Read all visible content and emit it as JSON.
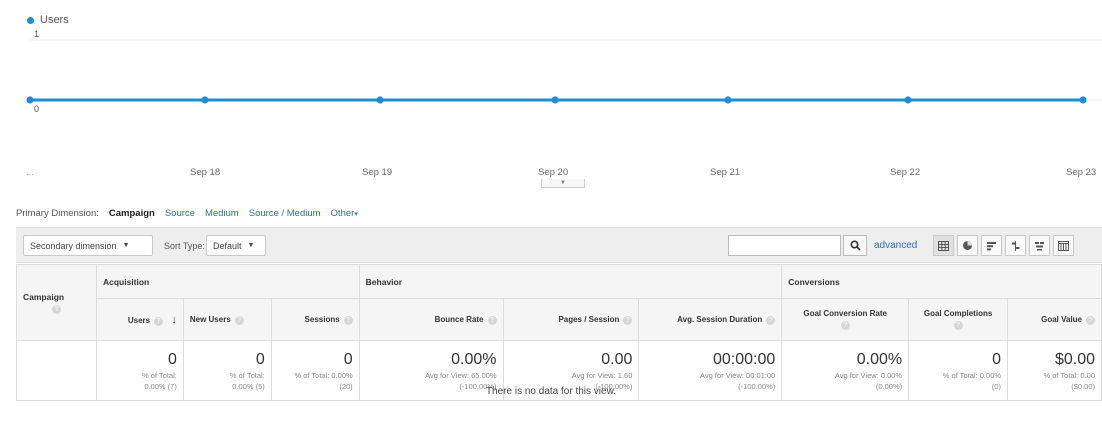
{
  "chart_data": {
    "type": "line",
    "series": [
      {
        "name": "Users",
        "color": "#1f8dd6",
        "values": [
          0,
          0,
          0,
          0,
          0,
          0,
          0
        ]
      }
    ],
    "x": [
      "",
      "Sep 18",
      "Sep 19",
      "Sep 20",
      "Sep 21",
      "Sep 22",
      "Sep 23"
    ],
    "y_ticks": [
      "1",
      "0"
    ],
    "ylim": [
      0,
      1
    ],
    "first_tick_label": "...",
    "grid": true,
    "legend": "top-left"
  },
  "primary_dimension": {
    "label": "Primary Dimension:",
    "active": "Campaign",
    "links": [
      "Source",
      "Medium",
      "Source / Medium",
      "Other"
    ],
    "other_suffix": "▾"
  },
  "toolbar": {
    "secondary_dimension": "Secondary dimension",
    "sort_type_label": "Sort Type:",
    "sort_type_value": "Default",
    "search_value": "",
    "advanced_label": "advanced",
    "view_icons": [
      "data-table-icon",
      "pie-chart-icon",
      "performance-bars-icon",
      "comparison-icon",
      "term-cloud-icon",
      "pivot-icon"
    ]
  },
  "table": {
    "groups": {
      "dimension": "Campaign",
      "acquisition": "Acquisition",
      "behavior": "Behavior",
      "conversions": "Conversions"
    },
    "columns": [
      "Users",
      "New Users",
      "Sessions",
      "Bounce Rate",
      "Pages / Session",
      "Avg. Session Duration",
      "Goal Conversion Rate",
      "Goal Completions",
      "Goal Value"
    ],
    "sort_indicator": "↓",
    "totals": [
      {
        "value": "0",
        "sub1": "% of Total:",
        "sub2": "0.00% (7)"
      },
      {
        "value": "0",
        "sub1": "% of Total:",
        "sub2": "0.00% (5)"
      },
      {
        "value": "0",
        "sub1": "% of Total: 0.00%",
        "sub2": "(20)"
      },
      {
        "value": "0.00%",
        "sub1": "Avg for View: 65.00%",
        "sub2": "(-100.00%)"
      },
      {
        "value": "0.00",
        "sub1": "Avg for View: 1.60",
        "sub2": "(-100.00%)"
      },
      {
        "value": "00:00:00",
        "sub1": "Avg for View: 00:01:00",
        "sub2": "(-100.00%)"
      },
      {
        "value": "0.00%",
        "sub1": "Avg for View: 0.00%",
        "sub2": "(0.00%)"
      },
      {
        "value": "0",
        "sub1": "% of Total: 0.00%",
        "sub2": "(0)"
      },
      {
        "value": "$0.00",
        "sub1": "% of Total: 0.00",
        "sub2": "($0.00)"
      }
    ],
    "empty_message": "There is no data for this view."
  }
}
